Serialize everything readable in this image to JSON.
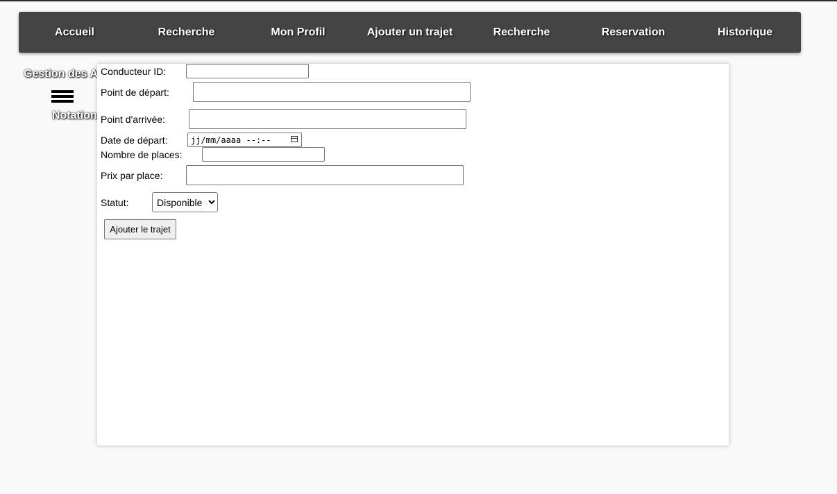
{
  "nav": {
    "items": [
      {
        "label": "Accueil"
      },
      {
        "label": "Recherche"
      },
      {
        "label": "Mon Profil"
      },
      {
        "label": "Ajouter un trajet"
      },
      {
        "label": "Recherche"
      },
      {
        "label": "Reservation"
      },
      {
        "label": "Historique"
      }
    ]
  },
  "sidebar": {
    "title_line1": "Gestion des Avis et",
    "title_line2": "Notation",
    "menu_icon": "hamburger-menu-icon"
  },
  "form": {
    "conducteur_label": "Conducteur ID:",
    "conducteur_value": "",
    "depart_label": "Point de départ:",
    "depart_value": "",
    "arrivee_label": "Point d'arrivée:",
    "arrivee_value": "",
    "date_label": "Date de départ:",
    "date_placeholder": "jj/mm/aaaa --:--",
    "places_label": "Nombre de places:",
    "places_value": "",
    "prix_label": "Prix par place:",
    "prix_value": "",
    "statut_label": "Statut:",
    "statut_selected": "Disponible",
    "submit_label": "Ajouter le trajet"
  },
  "colors": {
    "navbar": "#444444",
    "page_background": "#f9f9f9",
    "panel": "#ffffff"
  }
}
